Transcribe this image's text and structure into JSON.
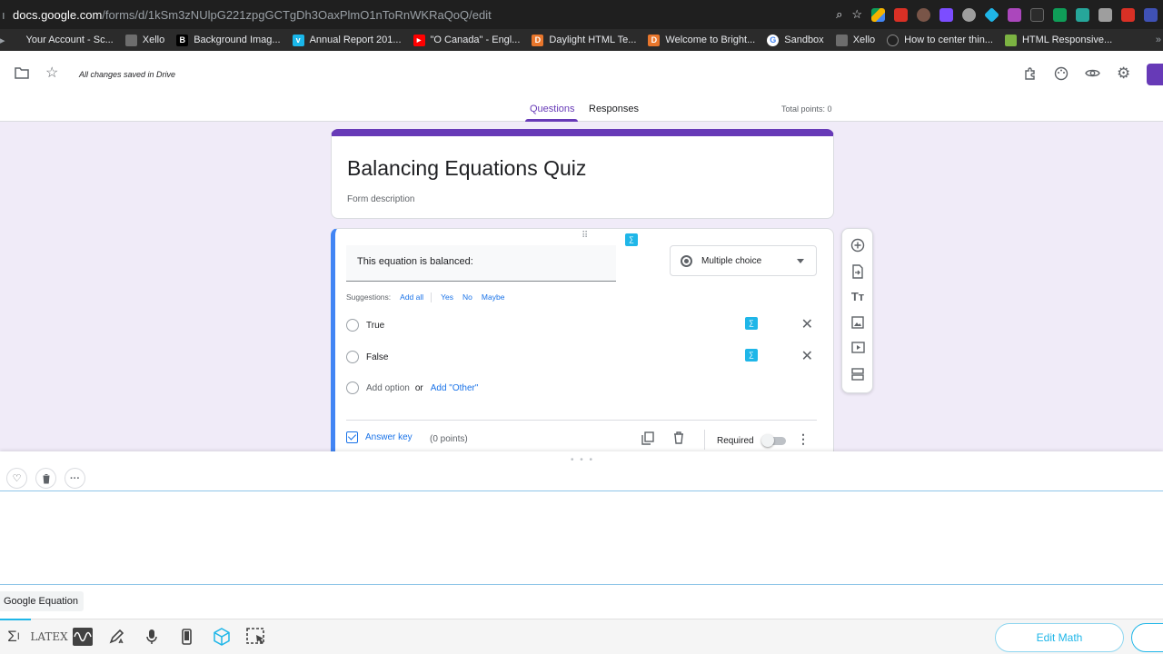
{
  "browser": {
    "url_host": "docs.google.com",
    "url_path": "/forms/d/1kSm3zNUlpG221zpgGCTgDh3OaxPlmO1nToRnWKRaQoQ/edit",
    "bookmarks": [
      {
        "label": "Your Account - Sc...",
        "fav": "",
        "color": "#1f1f1f"
      },
      {
        "label": "Xello",
        "fav": "",
        "color": "#6d6d6d"
      },
      {
        "label": "Background Imag...",
        "fav": "B",
        "color": "#000000"
      },
      {
        "label": "Annual Report 201...",
        "fav": "v",
        "color": "#1ab7ea"
      },
      {
        "label": "\"O Canada\" - Engl...",
        "fav": "▶",
        "color": "#ff0000"
      },
      {
        "label": "Daylight HTML Te...",
        "fav": "D",
        "color": "#e8762c"
      },
      {
        "label": "Welcome to Bright...",
        "fav": "D",
        "color": "#e8762c"
      },
      {
        "label": "Sandbox",
        "fav": "G",
        "color": "#4285f4"
      },
      {
        "label": "Xello",
        "fav": "",
        "color": "#6d6d6d"
      },
      {
        "label": "How to center thin...",
        "fav": "",
        "color": "#222222"
      },
      {
        "label": "HTML Responsive...",
        "fav": "",
        "color": "#7cb342"
      }
    ]
  },
  "forms": {
    "save_status": "All changes saved in Drive",
    "tabs": {
      "questions": "Questions",
      "responses": "Responses"
    },
    "total_points": "Total points: 0",
    "title": "Balancing Equations Quiz",
    "description_placeholder": "Form description"
  },
  "question": {
    "title": "This equation is balanced:",
    "type": "Multiple choice",
    "suggestions_label": "Suggestions:",
    "suggestions": [
      "Add all",
      "Yes",
      "No",
      "Maybe"
    ],
    "options": [
      "True",
      "False"
    ],
    "add_option": "Add option",
    "or": "or",
    "add_other": "Add \"Other\"",
    "answer_key": "Answer key",
    "points": "(0 points)",
    "required": "Required"
  },
  "equation_panel": {
    "tab_label": "Google Equation",
    "latex_label": "LATEX",
    "edit_math": "Edit Math"
  },
  "colors": {
    "accent": "#673ab7",
    "link": "#1a73e8",
    "equatio": "#1fb6e8"
  }
}
